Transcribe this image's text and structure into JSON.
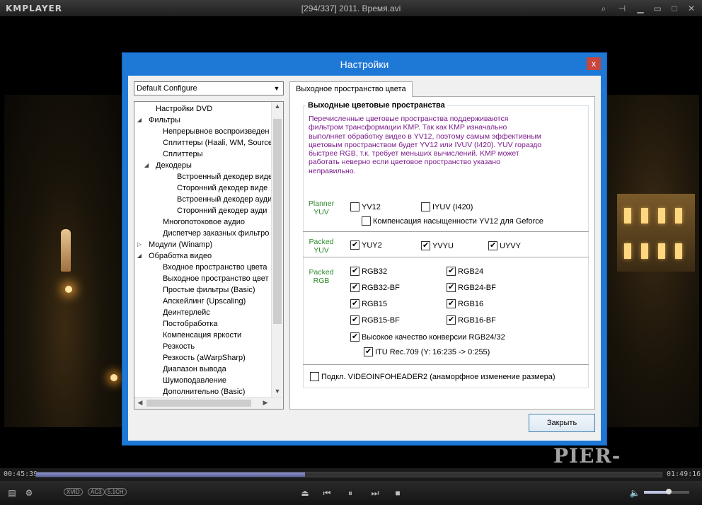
{
  "player": {
    "logo": "KMPLAYER",
    "title": "[294/337] 2011. Время.avi",
    "time_elapsed": "00:45:39",
    "time_total": "01:49:16",
    "progress": 0.43,
    "volume": 0.55,
    "codecs": [
      "XVID",
      "AC3",
      "5.1CH"
    ],
    "watermark": "PIER-NN.ORG"
  },
  "dialog": {
    "title": "Настройки",
    "close_glyph": "x",
    "preset": "Default Configure",
    "tree_items": [
      {
        "label": "Настройки DVD",
        "level": 1,
        "toggle": ""
      },
      {
        "label": "Фильтры",
        "level": 0,
        "toggle": "◢"
      },
      {
        "label": "Непрерывное воспроизведен",
        "level": 2,
        "toggle": ""
      },
      {
        "label": "Сплиттеры (Haali, WM, Source",
        "level": 2,
        "toggle": ""
      },
      {
        "label": "Сплиттеры",
        "level": 2,
        "toggle": ""
      },
      {
        "label": "Декодеры",
        "level": 1,
        "toggle": "◢"
      },
      {
        "label": "Встроенный декодер виде",
        "level": 3,
        "toggle": ""
      },
      {
        "label": "Сторонний декодер виде",
        "level": 3,
        "toggle": ""
      },
      {
        "label": "Встроенный декодер ауди",
        "level": 3,
        "toggle": ""
      },
      {
        "label": "Сторонний декодер ауди",
        "level": 3,
        "toggle": ""
      },
      {
        "label": "Многопотоковое аудио",
        "level": 2,
        "toggle": ""
      },
      {
        "label": "Диспетчер заказных фильтро",
        "level": 2,
        "toggle": ""
      },
      {
        "label": "Модули (Winamp)",
        "level": 0,
        "toggle": "▷"
      },
      {
        "label": "Обработка видео",
        "level": 0,
        "toggle": "◢"
      },
      {
        "label": "Входное пространство цвета",
        "level": 2,
        "toggle": ""
      },
      {
        "label": "Выходное пространство цвет",
        "level": 2,
        "toggle": ""
      },
      {
        "label": "Простые фильтры (Basic)",
        "level": 2,
        "toggle": ""
      },
      {
        "label": "Апскейлинг (Upscaling)",
        "level": 2,
        "toggle": ""
      },
      {
        "label": "Деинтерлейс",
        "level": 2,
        "toggle": ""
      },
      {
        "label": "Постобработка",
        "level": 2,
        "toggle": ""
      },
      {
        "label": "Компенсация яркости",
        "level": 2,
        "toggle": ""
      },
      {
        "label": "Резкость",
        "level": 2,
        "toggle": ""
      },
      {
        "label": "Резкость (aWarpSharp)",
        "level": 2,
        "toggle": ""
      },
      {
        "label": "Диапазон вывода",
        "level": 2,
        "toggle": ""
      },
      {
        "label": "Шумоподавление",
        "level": 2,
        "toggle": ""
      },
      {
        "label": "Дополнительно (Basic)",
        "level": 2,
        "toggle": ""
      }
    ],
    "tab_label": "Выходное пространство цвета",
    "group_title": "Выходные цветовые пространства",
    "description": "Перечисленные цветовые пространства поддерживаются фильтром трансформации KMP. Так как KMP изначально выполняет обработку видео в YV12, поэтому самым эффективным цветовым пространством будет YV12 или IVUV (I420). YUV гораздо быстрее RGB, т.к. требует меньших вычислений. KMP может работать неверно если цветовое пространство указано неправильно.",
    "sections": {
      "planner": "Planner YUV",
      "packed_yuv": "Packed YUV",
      "packed_rgb": "Packed RGB"
    },
    "checkboxes": {
      "yv12": {
        "label": "YV12",
        "checked": false
      },
      "iyuv": {
        "label": "IYUV (I420)",
        "checked": false
      },
      "geforce": {
        "label": "Компенсация насыщенности YV12 для Geforce",
        "checked": false
      },
      "yuy2": {
        "label": "YUY2",
        "checked": true
      },
      "yvyu": {
        "label": "YVYU",
        "checked": true
      },
      "uyvy": {
        "label": "UYVY",
        "checked": true
      },
      "rgb32": {
        "label": "RGB32",
        "checked": true
      },
      "rgb24": {
        "label": "RGB24",
        "checked": true
      },
      "rgb32bf": {
        "label": "RGB32-BF",
        "checked": true
      },
      "rgb24bf": {
        "label": "RGB24-BF",
        "checked": true
      },
      "rgb15": {
        "label": "RGB15",
        "checked": true
      },
      "rgb16": {
        "label": "RGB16",
        "checked": true
      },
      "rgb15bf": {
        "label": "RGB15-BF",
        "checked": true
      },
      "rgb16bf": {
        "label": "RGB16-BF",
        "checked": true
      },
      "hq": {
        "label": "Высокое качество конверсии RGB24/32",
        "checked": true
      },
      "itu": {
        "label": "ITU Rec.709 (Y: 16:235 -> 0:255)",
        "checked": true
      },
      "vih2": {
        "label": "Подкл. VIDEOINFOHEADER2 (анаморфное изменение размера)",
        "checked": false
      }
    },
    "close_button": "Закрыть"
  },
  "colors": {
    "dialog_frame": "#1e78d6",
    "description_text": "#7a1b8a",
    "section_label": "#2b8a2b",
    "close_x": "#c7463d"
  }
}
